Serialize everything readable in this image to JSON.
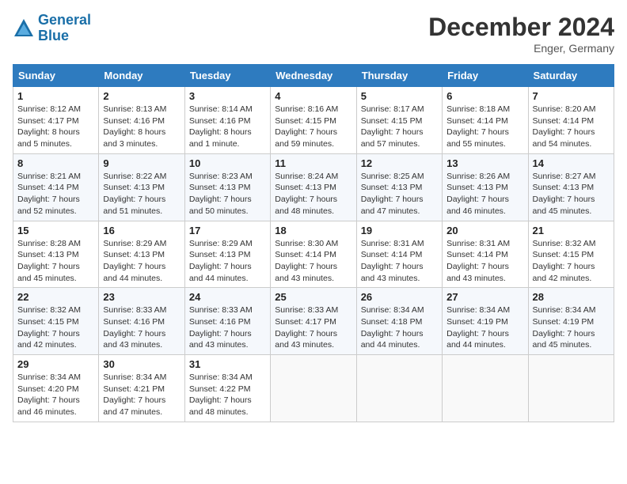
{
  "header": {
    "logo_line1": "General",
    "logo_line2": "Blue",
    "month_title": "December 2024",
    "location": "Enger, Germany"
  },
  "weekdays": [
    "Sunday",
    "Monday",
    "Tuesday",
    "Wednesday",
    "Thursday",
    "Friday",
    "Saturday"
  ],
  "weeks": [
    [
      {
        "day": "1",
        "info": "Sunrise: 8:12 AM\nSunset: 4:17 PM\nDaylight: 8 hours\nand 5 minutes."
      },
      {
        "day": "2",
        "info": "Sunrise: 8:13 AM\nSunset: 4:16 PM\nDaylight: 8 hours\nand 3 minutes."
      },
      {
        "day": "3",
        "info": "Sunrise: 8:14 AM\nSunset: 4:16 PM\nDaylight: 8 hours\nand 1 minute."
      },
      {
        "day": "4",
        "info": "Sunrise: 8:16 AM\nSunset: 4:15 PM\nDaylight: 7 hours\nand 59 minutes."
      },
      {
        "day": "5",
        "info": "Sunrise: 8:17 AM\nSunset: 4:15 PM\nDaylight: 7 hours\nand 57 minutes."
      },
      {
        "day": "6",
        "info": "Sunrise: 8:18 AM\nSunset: 4:14 PM\nDaylight: 7 hours\nand 55 minutes."
      },
      {
        "day": "7",
        "info": "Sunrise: 8:20 AM\nSunset: 4:14 PM\nDaylight: 7 hours\nand 54 minutes."
      }
    ],
    [
      {
        "day": "8",
        "info": "Sunrise: 8:21 AM\nSunset: 4:14 PM\nDaylight: 7 hours\nand 52 minutes."
      },
      {
        "day": "9",
        "info": "Sunrise: 8:22 AM\nSunset: 4:13 PM\nDaylight: 7 hours\nand 51 minutes."
      },
      {
        "day": "10",
        "info": "Sunrise: 8:23 AM\nSunset: 4:13 PM\nDaylight: 7 hours\nand 50 minutes."
      },
      {
        "day": "11",
        "info": "Sunrise: 8:24 AM\nSunset: 4:13 PM\nDaylight: 7 hours\nand 48 minutes."
      },
      {
        "day": "12",
        "info": "Sunrise: 8:25 AM\nSunset: 4:13 PM\nDaylight: 7 hours\nand 47 minutes."
      },
      {
        "day": "13",
        "info": "Sunrise: 8:26 AM\nSunset: 4:13 PM\nDaylight: 7 hours\nand 46 minutes."
      },
      {
        "day": "14",
        "info": "Sunrise: 8:27 AM\nSunset: 4:13 PM\nDaylight: 7 hours\nand 45 minutes."
      }
    ],
    [
      {
        "day": "15",
        "info": "Sunrise: 8:28 AM\nSunset: 4:13 PM\nDaylight: 7 hours\nand 45 minutes."
      },
      {
        "day": "16",
        "info": "Sunrise: 8:29 AM\nSunset: 4:13 PM\nDaylight: 7 hours\nand 44 minutes."
      },
      {
        "day": "17",
        "info": "Sunrise: 8:29 AM\nSunset: 4:13 PM\nDaylight: 7 hours\nand 44 minutes."
      },
      {
        "day": "18",
        "info": "Sunrise: 8:30 AM\nSunset: 4:14 PM\nDaylight: 7 hours\nand 43 minutes."
      },
      {
        "day": "19",
        "info": "Sunrise: 8:31 AM\nSunset: 4:14 PM\nDaylight: 7 hours\nand 43 minutes."
      },
      {
        "day": "20",
        "info": "Sunrise: 8:31 AM\nSunset: 4:14 PM\nDaylight: 7 hours\nand 43 minutes."
      },
      {
        "day": "21",
        "info": "Sunrise: 8:32 AM\nSunset: 4:15 PM\nDaylight: 7 hours\nand 42 minutes."
      }
    ],
    [
      {
        "day": "22",
        "info": "Sunrise: 8:32 AM\nSunset: 4:15 PM\nDaylight: 7 hours\nand 42 minutes."
      },
      {
        "day": "23",
        "info": "Sunrise: 8:33 AM\nSunset: 4:16 PM\nDaylight: 7 hours\nand 43 minutes."
      },
      {
        "day": "24",
        "info": "Sunrise: 8:33 AM\nSunset: 4:16 PM\nDaylight: 7 hours\nand 43 minutes."
      },
      {
        "day": "25",
        "info": "Sunrise: 8:33 AM\nSunset: 4:17 PM\nDaylight: 7 hours\nand 43 minutes."
      },
      {
        "day": "26",
        "info": "Sunrise: 8:34 AM\nSunset: 4:18 PM\nDaylight: 7 hours\nand 44 minutes."
      },
      {
        "day": "27",
        "info": "Sunrise: 8:34 AM\nSunset: 4:19 PM\nDaylight: 7 hours\nand 44 minutes."
      },
      {
        "day": "28",
        "info": "Sunrise: 8:34 AM\nSunset: 4:19 PM\nDaylight: 7 hours\nand 45 minutes."
      }
    ],
    [
      {
        "day": "29",
        "info": "Sunrise: 8:34 AM\nSunset: 4:20 PM\nDaylight: 7 hours\nand 46 minutes."
      },
      {
        "day": "30",
        "info": "Sunrise: 8:34 AM\nSunset: 4:21 PM\nDaylight: 7 hours\nand 47 minutes."
      },
      {
        "day": "31",
        "info": "Sunrise: 8:34 AM\nSunset: 4:22 PM\nDaylight: 7 hours\nand 48 minutes."
      },
      null,
      null,
      null,
      null
    ]
  ]
}
